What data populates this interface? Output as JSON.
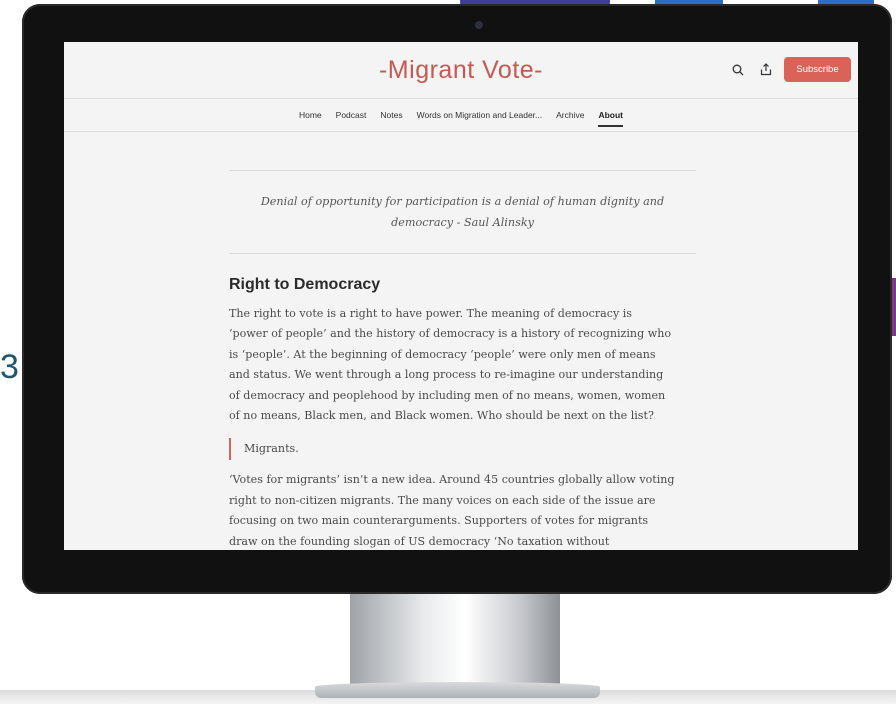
{
  "site": {
    "title": "-Migrant Vote-",
    "subscribe_label": "Subscribe"
  },
  "icons": {
    "search": "search-icon",
    "share": "share-icon"
  },
  "nav": {
    "items": [
      {
        "label": "Home"
      },
      {
        "label": "Podcast"
      },
      {
        "label": "Notes"
      },
      {
        "label": "Words on Migration and Leader..."
      },
      {
        "label": "Archive"
      },
      {
        "label": "About",
        "active": true
      }
    ]
  },
  "article": {
    "quote_line1": "Denial of opportunity for participation is a denial of human dignity and",
    "quote_line2": "democracy - Saul Alinsky",
    "heading": "Right to Democracy",
    "para1_lines": [
      "The right to vote is a right to have power. The meaning of democracy is",
      "‘power of people’ and the history of democracy is a history of recognizing who",
      "is ‘people’. At the beginning of democracy ‘people’ were only men of means",
      "and status. We went through a long process to re-imagine our understanding",
      "of democracy and peoplehood by including men of no means, women, women",
      "of no means, Black men, and Black women. Who should be next on the list?"
    ],
    "blockquote": "Migrants.",
    "para2_lines": [
      "‘Votes for migrants’ isn’t a new idea. Around 45 countries globally allow voting",
      "right to non-citizen migrants. The many voices on each side of the issue are",
      "focusing on two main counterarguments. Supporters of votes for migrants",
      "draw on the founding slogan of US democracy ‘No taxation without"
    ]
  },
  "background": {
    "edge_letter": "3"
  },
  "colors": {
    "accent": "#d96259",
    "title": "#c65a52",
    "purple": "#3f3d9c",
    "blue": "#2c6fc9"
  }
}
